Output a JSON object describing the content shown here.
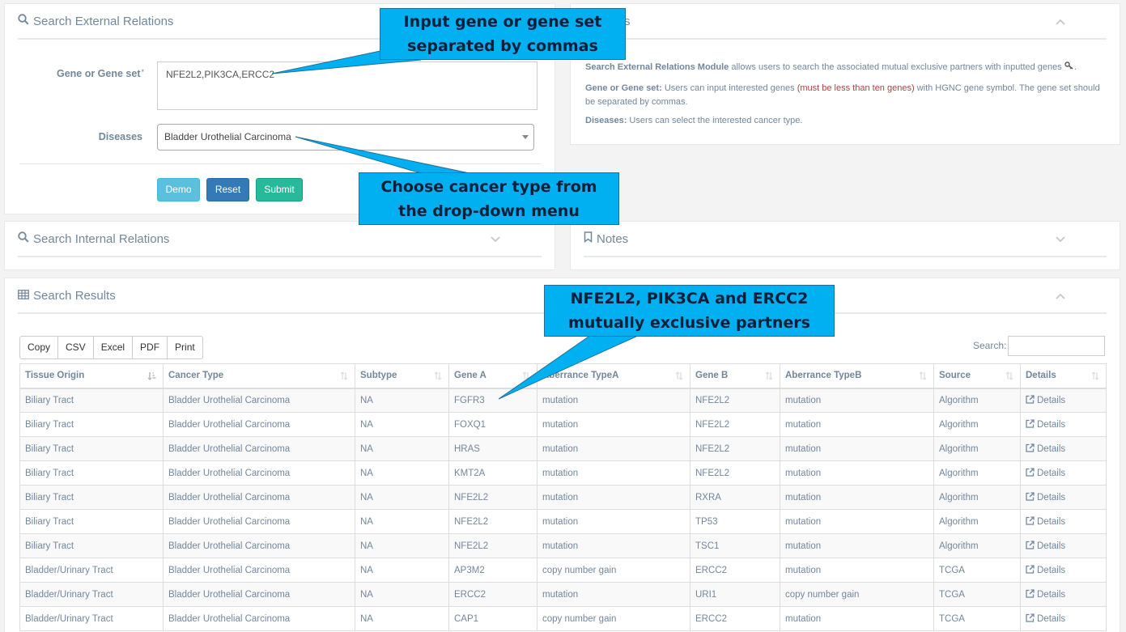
{
  "external": {
    "title": "Search External Relations",
    "gene_label": "Gene or Gene set",
    "required_mark": "*",
    "gene_value": "NFE2L2,PIK3CA,ERCC2",
    "disease_label": "Diseases",
    "disease_value": "Bladder Urothelial Carcinoma",
    "buttons": {
      "demo": "Demo",
      "reset": "Reset",
      "submit": "Submit"
    }
  },
  "help": {
    "title_fragment": "s",
    "p1_bold": "Search External Relations Module",
    "p1_text": " allows users to search the associated mutual exclusive partners with inputted genes",
    "p1_end": ".",
    "p2_bold": "Gene or Gene set:",
    "p2_text": " Users can input interested genes ",
    "p2_warn": "(must be less than ten genes)",
    "p2_text2": " with HGNC gene symbol. The gene set should be separated by commas.",
    "p3_bold": "Diseases:",
    "p3_text": " Users can select the interested cancer type."
  },
  "internal": {
    "title": "Search Internal Relations"
  },
  "notes": {
    "title": "Notes"
  },
  "results": {
    "title": "Search Results",
    "toolbar": [
      "Copy",
      "CSV",
      "Excel",
      "PDF",
      "Print"
    ],
    "search_label": "Search:",
    "columns": [
      "Tissue Origin",
      "Cancer Type",
      "Subtype",
      "Gene A",
      "Aberrance TypeA",
      "Gene B",
      "Aberrance TypeB",
      "Source",
      "Details"
    ],
    "details_label": "Details",
    "rows": [
      [
        "Biliary Tract",
        "Bladder Urothelial Carcinoma",
        "NA",
        "FGFR3",
        "mutation",
        "NFE2L2",
        "mutation",
        "Algorithm"
      ],
      [
        "Biliary Tract",
        "Bladder Urothelial Carcinoma",
        "NA",
        "FOXQ1",
        "mutation",
        "NFE2L2",
        "mutation",
        "Algorithm"
      ],
      [
        "Biliary Tract",
        "Bladder Urothelial Carcinoma",
        "NA",
        "HRAS",
        "mutation",
        "NFE2L2",
        "mutation",
        "Algorithm"
      ],
      [
        "Biliary Tract",
        "Bladder Urothelial Carcinoma",
        "NA",
        "KMT2A",
        "mutation",
        "NFE2L2",
        "mutation",
        "Algorithm"
      ],
      [
        "Biliary Tract",
        "Bladder Urothelial Carcinoma",
        "NA",
        "NFE2L2",
        "mutation",
        "RXRA",
        "mutation",
        "Algorithm"
      ],
      [
        "Biliary Tract",
        "Bladder Urothelial Carcinoma",
        "NA",
        "NFE2L2",
        "mutation",
        "TP53",
        "mutation",
        "Algorithm"
      ],
      [
        "Biliary Tract",
        "Bladder Urothelial Carcinoma",
        "NA",
        "NFE2L2",
        "mutation",
        "TSC1",
        "mutation",
        "Algorithm"
      ],
      [
        "Bladder/Urinary Tract",
        "Bladder Urothelial Carcinoma",
        "NA",
        "AP3M2",
        "copy number gain",
        "ERCC2",
        "mutation",
        "TCGA"
      ],
      [
        "Bladder/Urinary Tract",
        "Bladder Urothelial Carcinoma",
        "NA",
        "ERCC2",
        "mutation",
        "URI1",
        "copy number gain",
        "TCGA"
      ],
      [
        "Bladder/Urinary Tract",
        "Bladder Urothelial Carcinoma",
        "NA",
        "CAP1",
        "copy number gain",
        "ERCC2",
        "mutation",
        "TCGA"
      ]
    ]
  },
  "callouts": {
    "input": {
      "line1": "Input gene or gene set",
      "line2": "separated by commas"
    },
    "choose": {
      "line1": "Choose cancer type from",
      "line2": "the drop-down menu"
    },
    "partners": {
      "line1": "NFE2L2, PIK3CA and ERCC2",
      "line2": "mutually exclusive partners"
    }
  },
  "colors": {
    "callout_fill": "#00b0f0",
    "btn_demo": "#5bc0de",
    "btn_reset": "#337ab7",
    "btn_submit": "#26b99a",
    "warning_text": "#a94442"
  }
}
